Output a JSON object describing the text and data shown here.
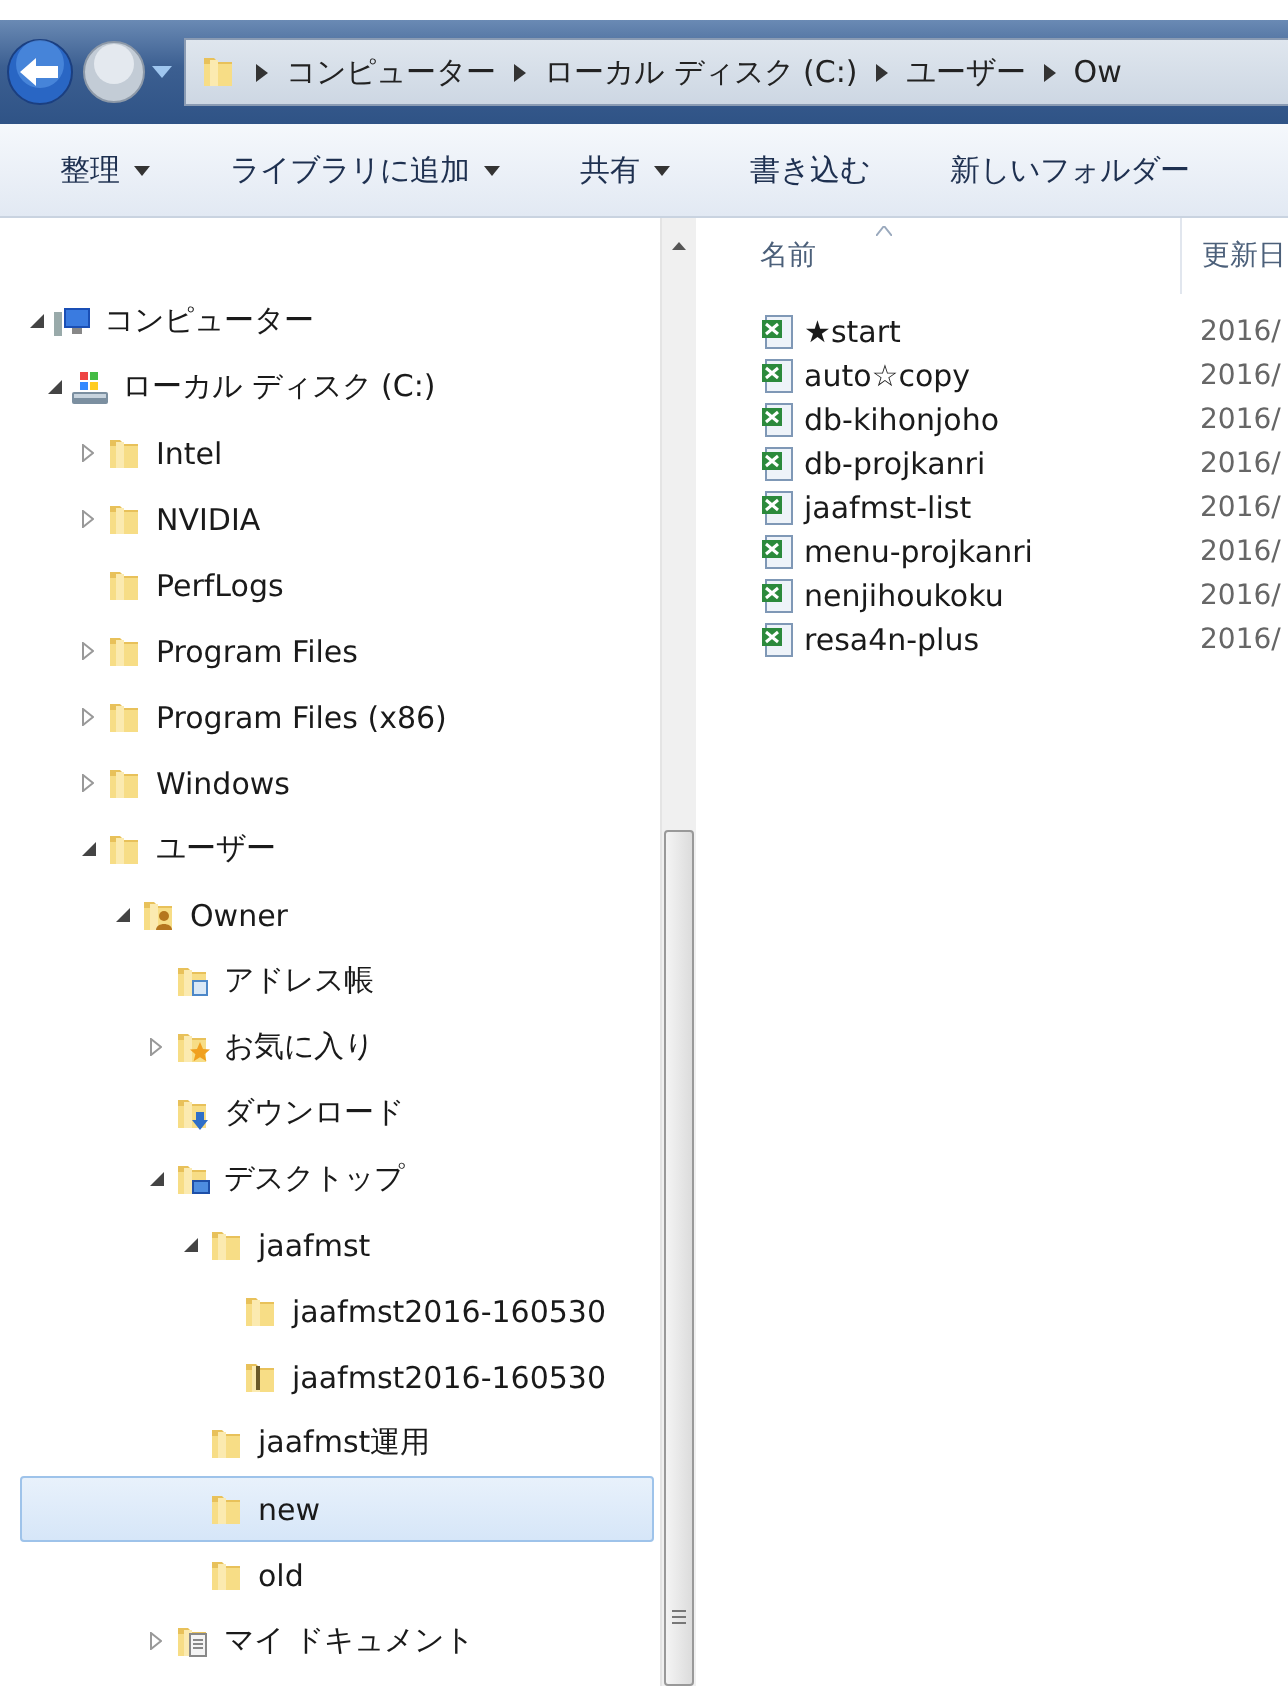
{
  "address_bar": {
    "segments": [
      "コンピューター",
      "ローカル ディスク (C:)",
      "ユーザー",
      "Ow"
    ]
  },
  "toolbar": {
    "buttons": [
      {
        "label": "整理",
        "dropdown": true
      },
      {
        "label": "ライブラリに追加",
        "dropdown": true
      },
      {
        "label": "共有",
        "dropdown": true
      },
      {
        "label": "書き込む",
        "dropdown": false
      },
      {
        "label": "新しいフォルダー",
        "dropdown": false
      }
    ]
  },
  "navigation_tree": {
    "items": [
      {
        "label": "コンピューター",
        "kind": "computer",
        "has_children": true,
        "expanded": true,
        "selected": false,
        "children": [
          {
            "label": "ローカル ディスク (C:)",
            "kind": "drive",
            "has_children": true,
            "expanded": true,
            "selected": false,
            "children": [
              {
                "label": "Intel",
                "kind": "folder",
                "has_children": true,
                "expanded": false,
                "selected": false
              },
              {
                "label": "NVIDIA",
                "kind": "folder",
                "has_children": true,
                "expanded": false,
                "selected": false
              },
              {
                "label": "PerfLogs",
                "kind": "folder",
                "has_children": false,
                "selected": false
              },
              {
                "label": "Program Files",
                "kind": "folder",
                "has_children": true,
                "expanded": false,
                "selected": false
              },
              {
                "label": "Program Files (x86)",
                "kind": "folder",
                "has_children": true,
                "expanded": false,
                "selected": false
              },
              {
                "label": "Windows",
                "kind": "folder",
                "has_children": true,
                "expanded": false,
                "selected": false
              },
              {
                "label": "ユーザー",
                "kind": "folder",
                "has_children": true,
                "expanded": true,
                "selected": false,
                "children": [
                  {
                    "label": "Owner",
                    "kind": "user",
                    "has_children": true,
                    "expanded": true,
                    "selected": false,
                    "children": [
                      {
                        "label": "アドレス帳",
                        "kind": "contacts",
                        "has_children": false,
                        "selected": false
                      },
                      {
                        "label": "お気に入り",
                        "kind": "favorites",
                        "has_children": true,
                        "expanded": false,
                        "selected": false
                      },
                      {
                        "label": "ダウンロード",
                        "kind": "downloads",
                        "has_children": false,
                        "selected": false
                      },
                      {
                        "label": "デスクトップ",
                        "kind": "desktop",
                        "has_children": true,
                        "expanded": true,
                        "selected": false,
                        "children": [
                          {
                            "label": "jaafmst",
                            "kind": "folder",
                            "has_children": true,
                            "expanded": true,
                            "selected": false,
                            "children": [
                              {
                                "label": "jaafmst2016-160530",
                                "kind": "folder",
                                "has_children": false,
                                "selected": false
                              },
                              {
                                "label": "jaafmst2016-160530",
                                "kind": "zip",
                                "has_children": false,
                                "selected": false
                              }
                            ]
                          },
                          {
                            "label": "jaafmst運用",
                            "kind": "folder",
                            "has_children": false,
                            "selected": false
                          },
                          {
                            "label": "new",
                            "kind": "folder",
                            "has_children": false,
                            "selected": true
                          },
                          {
                            "label": "old",
                            "kind": "folder",
                            "has_children": false,
                            "selected": false
                          }
                        ]
                      },
                      {
                        "label": "マイ ドキュメント",
                        "kind": "documents",
                        "has_children": true,
                        "expanded": false,
                        "selected": false
                      }
                    ]
                  }
                ]
              }
            ]
          }
        ]
      }
    ]
  },
  "file_list": {
    "columns": [
      "名前",
      "更新日"
    ],
    "rows": [
      {
        "name": "★start",
        "modified": "2016/"
      },
      {
        "name": "auto☆copy",
        "modified": "2016/"
      },
      {
        "name": "db-kihonjoho",
        "modified": "2016/"
      },
      {
        "name": "db-projkanri",
        "modified": "2016/"
      },
      {
        "name": "jaafmst-list",
        "modified": "2016/"
      },
      {
        "name": "menu-projkanri",
        "modified": "2016/"
      },
      {
        "name": "nenjihoukoku",
        "modified": "2016/"
      },
      {
        "name": "resa4n-plus",
        "modified": "2016/"
      }
    ]
  }
}
